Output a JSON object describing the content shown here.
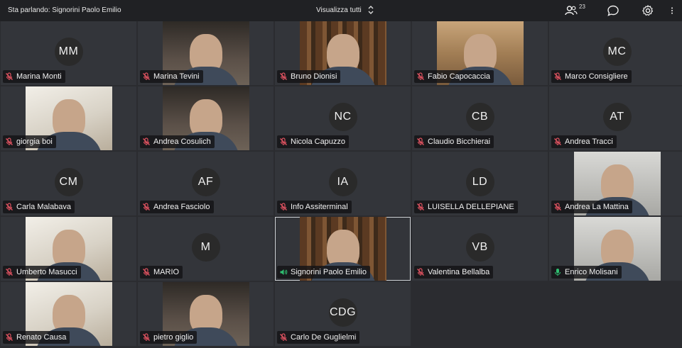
{
  "header": {
    "speaking_label": "Sta parlando: Signorini Paolo Emilio",
    "view_label": "Visualizza tutti",
    "participants_count": "23"
  },
  "colors": {
    "muted": "#e05260",
    "unmuted": "#2fbf71",
    "tile": "#33353a",
    "bar": "#202124"
  },
  "participants": [
    {
      "name": "Marina Monti",
      "initials": "MM",
      "mic": "muted",
      "video": false
    },
    {
      "name": "Marina Tevini",
      "initials": "",
      "mic": "muted",
      "video": true
    },
    {
      "name": "Bruno Dionisi",
      "initials": "",
      "mic": "muted",
      "video": true
    },
    {
      "name": "Fabio Capocaccia",
      "initials": "",
      "mic": "muted",
      "video": true
    },
    {
      "name": "Marco Consigliere",
      "initials": "MC",
      "mic": "muted",
      "video": false
    },
    {
      "name": "giorgia boi",
      "initials": "",
      "mic": "muted",
      "video": true
    },
    {
      "name": "Andrea Cosulich",
      "initials": "",
      "mic": "muted",
      "video": true
    },
    {
      "name": "Nicola Capuzzo",
      "initials": "NC",
      "mic": "muted",
      "video": false
    },
    {
      "name": "Claudio Bicchierai",
      "initials": "CB",
      "mic": "muted",
      "video": false
    },
    {
      "name": "Andrea Tracci",
      "initials": "AT",
      "mic": "muted",
      "video": false
    },
    {
      "name": "Carla Malabava",
      "initials": "CM",
      "mic": "muted",
      "video": false
    },
    {
      "name": "Andrea Fasciolo",
      "initials": "AF",
      "mic": "muted",
      "video": false
    },
    {
      "name": "Info Assiterminal",
      "initials": "IA",
      "mic": "muted",
      "video": false
    },
    {
      "name": "LUISELLA DELLEPIANE",
      "initials": "LD",
      "mic": "muted",
      "video": false
    },
    {
      "name": "Andrea La Mattina",
      "initials": "",
      "mic": "muted",
      "video": true
    },
    {
      "name": "Umberto Masucci",
      "initials": "",
      "mic": "muted",
      "video": true
    },
    {
      "name": "MARIO",
      "initials": "M",
      "mic": "muted",
      "video": false
    },
    {
      "name": "Signorini Paolo Emilio",
      "initials": "",
      "mic": "speaking",
      "video": true
    },
    {
      "name": "Valentina Bellalba",
      "initials": "VB",
      "mic": "muted",
      "video": false
    },
    {
      "name": "Enrico Molisani",
      "initials": "",
      "mic": "unmuted",
      "video": true
    },
    {
      "name": "Renato Causa",
      "initials": "",
      "mic": "muted",
      "video": true
    },
    {
      "name": "pietro giglio",
      "initials": "",
      "mic": "muted",
      "video": true
    },
    {
      "name": "Carlo De Guglielmi",
      "initials": "CDG",
      "mic": "muted",
      "video": false
    }
  ]
}
